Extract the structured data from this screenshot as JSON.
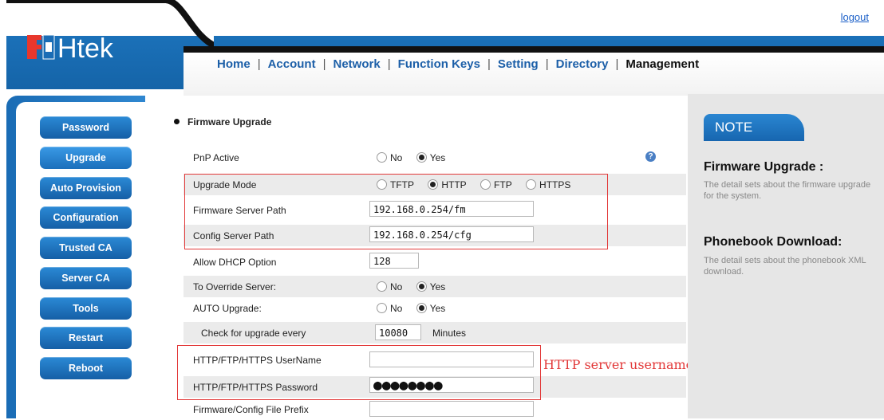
{
  "header": {
    "logout": "logout",
    "logo_text": "Htek",
    "nav": [
      "Home",
      "Account",
      "Network",
      "Function Keys",
      "Setting",
      "Directory",
      "Management"
    ],
    "active_nav": "Management"
  },
  "sidebar": {
    "items": [
      "Password",
      "Upgrade",
      "Auto Provision",
      "Configuration",
      "Trusted CA",
      "Server CA",
      "Tools",
      "Restart",
      "Reboot"
    ],
    "active": "Upgrade"
  },
  "main": {
    "section_title": "Firmware Upgrade",
    "pnp_active": {
      "label": "PnP Active",
      "options": [
        "No",
        "Yes"
      ],
      "selected": "Yes"
    },
    "upgrade_mode": {
      "label": "Upgrade Mode",
      "options": [
        "TFTP",
        "HTTP",
        "FTP",
        "HTTPS"
      ],
      "selected": "HTTP"
    },
    "firmware_server_path": {
      "label": "Firmware Server Path",
      "value": "192.168.0.254/fm"
    },
    "config_server_path": {
      "label": "Config Server Path",
      "value": "192.168.0.254/cfg"
    },
    "allow_dhcp_option": {
      "label": "Allow DHCP Option",
      "value": "128"
    },
    "to_override_server": {
      "label": "To Override Server:",
      "options": [
        "No",
        "Yes"
      ],
      "selected": "Yes"
    },
    "auto_upgrade": {
      "label": "AUTO Upgrade:",
      "options": [
        "No",
        "Yes"
      ],
      "selected": "Yes"
    },
    "check_every": {
      "label": "Check for upgrade every",
      "value": "10080",
      "unit": "Minutes"
    },
    "username": {
      "label": "HTTP/FTP/HTTPS UserName",
      "value": ""
    },
    "password": {
      "label": "HTTP/FTP/HTTPS Password",
      "value": "●●●●●●●●"
    },
    "file_prefix": {
      "label": "Firmware/Config File Prefix",
      "value": ""
    },
    "help_icon": "?",
    "annotation": "HTTP server username and password"
  },
  "note": {
    "tab": "NOTE",
    "h1": "Firmware Upgrade :",
    "p1": "The detail sets about the firmware upgrade for the system.",
    "h2": "Phonebook Download:",
    "p2": "The detail sets about the phonebook XML download."
  },
  "colors": {
    "brand_blue": "#1a6cb5",
    "annotation_red": "#e23838",
    "note_bg": "#e6e6e6"
  }
}
